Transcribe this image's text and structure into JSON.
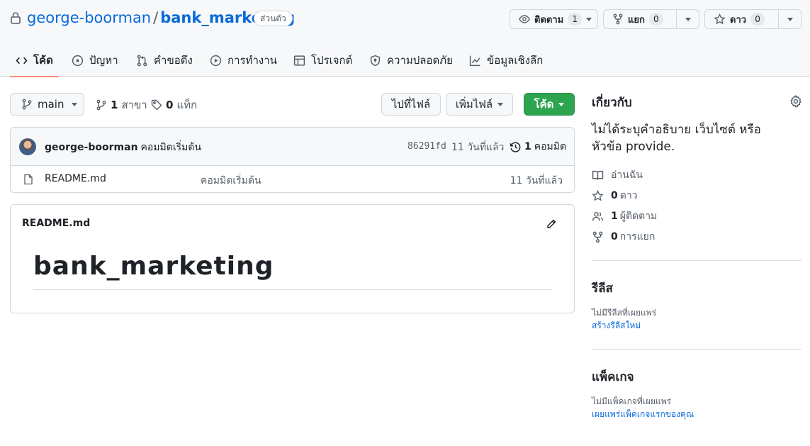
{
  "repo": {
    "owner": "george-boorman",
    "separator": "/",
    "name": "bank_marketing",
    "visibility": "ส่วนตัว"
  },
  "actions": {
    "watch": {
      "label": "ติดตาม",
      "count": "1"
    },
    "fork": {
      "label": "แยก",
      "count": "0"
    },
    "star": {
      "label": "ดาว",
      "count": "0"
    }
  },
  "tabs": [
    {
      "label": "โค้ด",
      "icon": "code-icon"
    },
    {
      "label": "ปัญหา",
      "icon": "issue-icon"
    },
    {
      "label": "คำขอดึง",
      "icon": "pull-request-icon"
    },
    {
      "label": "การทำงาน",
      "icon": "play-icon"
    },
    {
      "label": "โปรเจกต์",
      "icon": "table-icon"
    },
    {
      "label": "ความปลอดภัย",
      "icon": "shield-icon"
    },
    {
      "label": "ข้อมูลเชิงลึก",
      "icon": "graph-icon"
    }
  ],
  "toolbar": {
    "branch": "main",
    "branches_count": "1",
    "branches_label": "สาขา",
    "tags_count": "0",
    "tags_label": "แท็ก",
    "go_to_file": "ไปที่ไฟล์",
    "add_file": "เพิ่มไฟล์",
    "code": "โค้ด"
  },
  "commit": {
    "author": "george-boorman",
    "message": "คอมมิตเริ่มต้น",
    "sha": "86291fd",
    "time": "11 วันที่แล้ว",
    "count": "1",
    "count_label": "คอมมิต"
  },
  "files": [
    {
      "name": "README.md",
      "message": "คอมมิตเริ่มต้น",
      "time": "11 วันที่แล้ว"
    }
  ],
  "readme": {
    "header": "README.md",
    "title": "bank_marketing"
  },
  "about": {
    "title": "เกี่ยวกับ",
    "description": "ไม่ได้ระบุคำอธิบาย เว็บไซต์ หรือหัวข้อ provide.",
    "readme": "อ่านฉัน",
    "stars_count": "0",
    "stars_label": "ดาว",
    "watchers_count": "1",
    "watchers_label": "ผู้ติดตาม",
    "forks_count": "0",
    "forks_label": "การแยก"
  },
  "releases": {
    "title": "รีลีส",
    "empty": "ไม่มีรีลีสที่เผยแพร่",
    "create_link": "สร้างรีลีสใหม่"
  },
  "packages": {
    "title": "แพ็คเกจ",
    "empty": "ไม่มีแพ็คเกจที่เผยแพร่",
    "publish_link": "เผยแพร่แพ็คเกจแรกของคุณ"
  },
  "colors": {
    "link": "#0969da",
    "primary_button": "#2da44e",
    "active_tab_underline": "#fd8c73"
  }
}
